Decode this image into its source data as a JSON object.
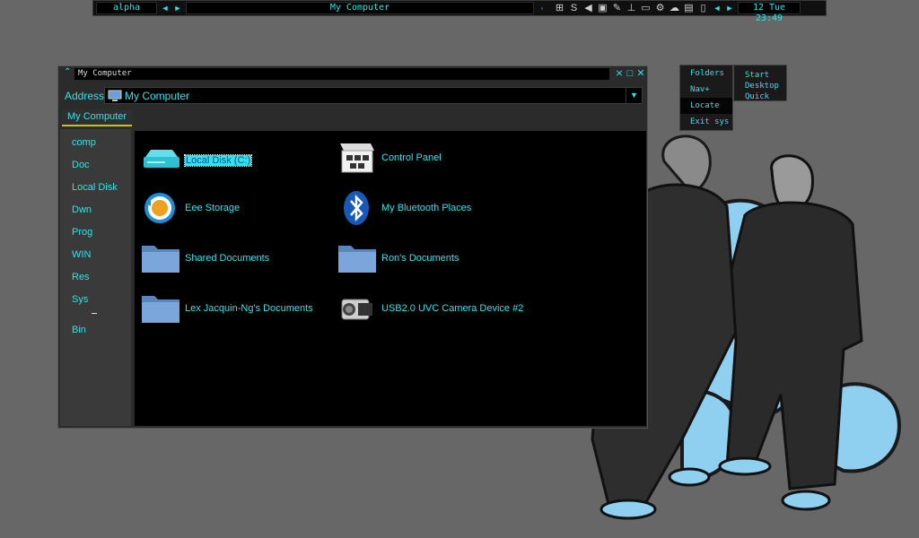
{
  "taskbar": {
    "workspace": "alpha",
    "window_title": "My Computer",
    "clock": "12 Tue 23:49",
    "nav_prev": "◄",
    "nav_next": "►"
  },
  "menu": {
    "primary": [
      {
        "label": "Folders"
      },
      {
        "label": "Nav+"
      },
      {
        "label": "Locate"
      },
      {
        "label": "Exit sys"
      }
    ],
    "secondary": [
      {
        "label": "Start"
      },
      {
        "label": "Desktop"
      },
      {
        "label": "Quick"
      }
    ]
  },
  "window": {
    "title": "My Computer",
    "address_label": "Address",
    "address_value": "My Computer",
    "tab": "My Computer",
    "controls": {
      "minimize": "⨯",
      "maximize": "□",
      "close": "✕"
    },
    "sidebar": [
      {
        "label": "comp"
      },
      {
        "label": "Doc"
      },
      {
        "label": "Local Disk"
      },
      {
        "label": "Dwn"
      },
      {
        "label": "Prog"
      },
      {
        "label": "WIN"
      },
      {
        "label": "Res"
      },
      {
        "label": "Sys"
      },
      {
        "label": "Bin"
      }
    ],
    "items": [
      {
        "label": "Local Disk (C:)",
        "icon": "drive-icon",
        "selected": true
      },
      {
        "label": "Control Panel",
        "icon": "control-panel-icon"
      },
      {
        "label": "Eee Storage",
        "icon": "sync-icon"
      },
      {
        "label": "My Bluetooth Places",
        "icon": "bluetooth-icon"
      },
      {
        "label": "Shared Documents",
        "icon": "folder-icon"
      },
      {
        "label": "Ron's Documents",
        "icon": "folder-icon"
      },
      {
        "label": "Lex Jacquin-Ng's Documents",
        "icon": "folder-icon"
      },
      {
        "label": "USB2.0 UVC Camera Device #2",
        "icon": "camera-icon"
      }
    ]
  },
  "colors": {
    "accent": "#35e0e8",
    "desktop": "#676767",
    "tab_underline": "#c7c410"
  }
}
